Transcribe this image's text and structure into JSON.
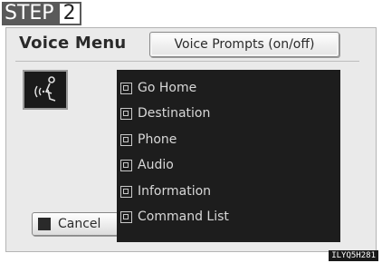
{
  "step": {
    "label": "STEP",
    "number": "2"
  },
  "screen": {
    "title": "Voice Menu",
    "prompts_button": "Voice Prompts (on/off)",
    "cancel_button": "Cancel",
    "voice_icon": "voice-command-icon",
    "items": [
      {
        "label": "Go Home"
      },
      {
        "label": "Destination"
      },
      {
        "label": "Phone"
      },
      {
        "label": "Audio"
      },
      {
        "label": "Information"
      },
      {
        "label": "Command List"
      }
    ]
  },
  "figure_code": "ILYQ5H281",
  "colors": {
    "list_bg": "#1d1d1d",
    "screen_bg": "#eaeaea",
    "step_bg": "#5a5a5a"
  }
}
